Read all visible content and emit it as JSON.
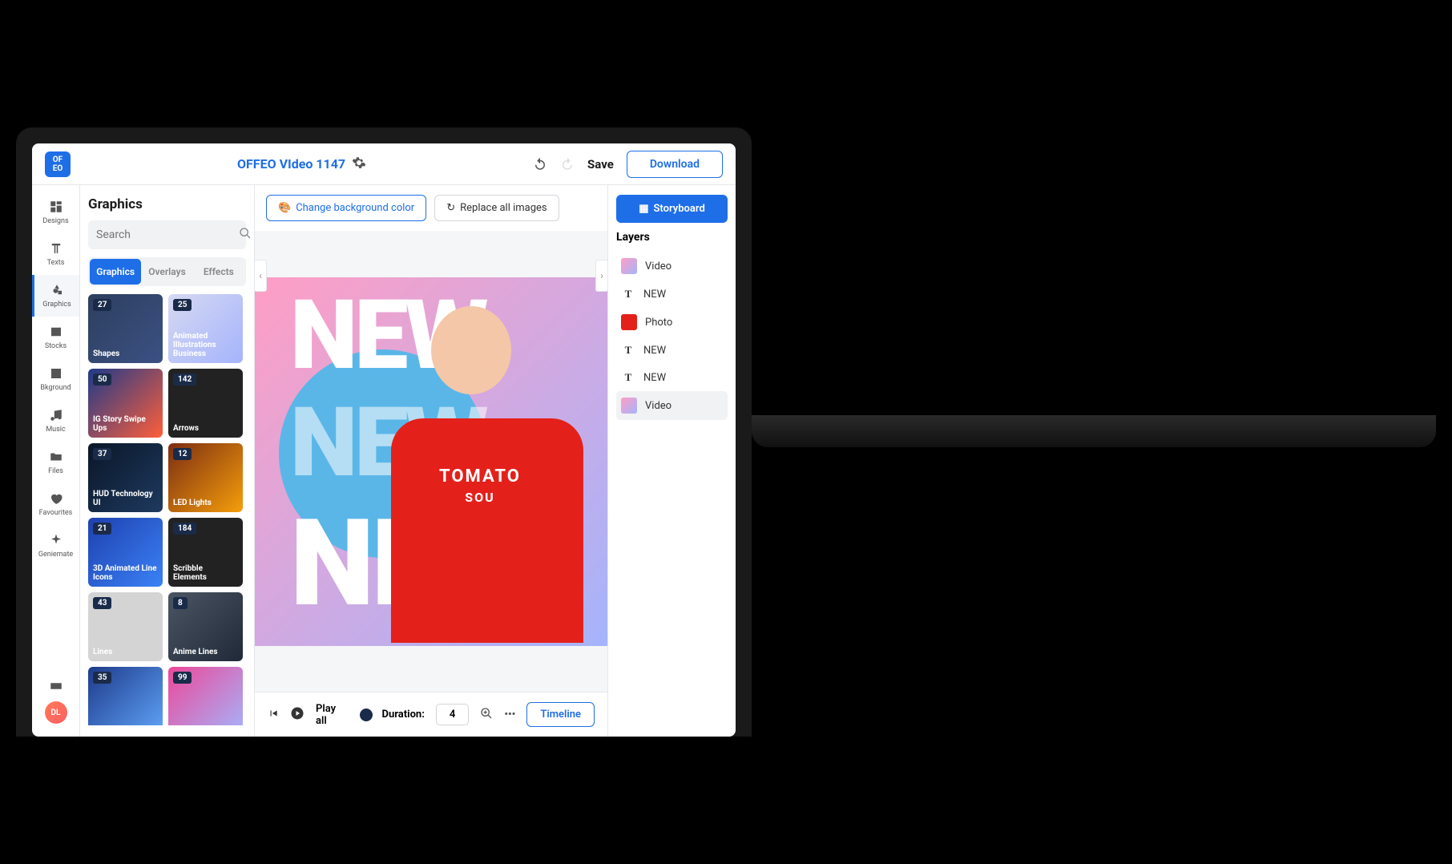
{
  "header": {
    "title": "OFFEO VIdeo 1147",
    "save_label": "Save",
    "download_label": "Download",
    "logo_text": "OF EO"
  },
  "left_nav": {
    "items": [
      {
        "label": "Designs"
      },
      {
        "label": "Texts"
      },
      {
        "label": "Graphics"
      },
      {
        "label": "Stocks"
      },
      {
        "label": "Bkground"
      },
      {
        "label": "Music"
      },
      {
        "label": "Files"
      },
      {
        "label": "Favourites"
      },
      {
        "label": "Geniemate"
      }
    ],
    "avatar_initials": "DL"
  },
  "graphics_panel": {
    "title": "Graphics",
    "search_placeholder": "Search",
    "tabs": [
      {
        "label": "Graphics"
      },
      {
        "label": "Overlays"
      },
      {
        "label": "Effects"
      }
    ],
    "cards": [
      {
        "count": "27",
        "label": "Shapes",
        "bg": "linear-gradient(135deg,#2d3e5e,#3b5183)"
      },
      {
        "count": "25",
        "label": "Animated Illustrations Business",
        "bg": "linear-gradient(135deg,#d6d9f2,#a5b4fc)"
      },
      {
        "count": "50",
        "label": "IG Story Swipe Ups",
        "bg": "linear-gradient(135deg,#1e3a8a,#ff5e3a)"
      },
      {
        "count": "142",
        "label": "Arrows",
        "bg": "#222"
      },
      {
        "count": "37",
        "label": "HUD Technology UI",
        "bg": "linear-gradient(135deg,#0a1628,#1e3a5f)"
      },
      {
        "count": "12",
        "label": "LED Lights",
        "bg": "linear-gradient(135deg,#7c2d12,#f59e0b)"
      },
      {
        "count": "21",
        "label": "3D Animated Line Icons",
        "bg": "linear-gradient(135deg,#1e40af,#3b82f6)"
      },
      {
        "count": "184",
        "label": "Scribble Elements",
        "bg": "#222"
      },
      {
        "count": "43",
        "label": "Lines",
        "bg": "#d4d4d4"
      },
      {
        "count": "8",
        "label": "Anime Lines",
        "bg": "linear-gradient(135deg,#4b5563,#1f2937)"
      },
      {
        "count": "35",
        "label": "",
        "bg": "linear-gradient(135deg,#1e3a8a,#60a5fa)"
      },
      {
        "count": "99",
        "label": "",
        "bg": "linear-gradient(135deg,#ec4899,#a5b4fc)"
      }
    ]
  },
  "toolbar": {
    "change_bg_label": "Change background color",
    "replace_label": "Replace all images"
  },
  "canvas": {
    "text1": "NEW",
    "text2": "NEW",
    "text3": "NEW",
    "person_shirt_line1": "TOMATO",
    "person_shirt_line2": "SOU"
  },
  "playbar": {
    "play_all_label": "Play all",
    "duration_label": "Duration:",
    "duration_value": "4",
    "timeline_label": "Timeline"
  },
  "layers_panel": {
    "storyboard_label": "Storyboard",
    "title": "Layers",
    "layers": [
      {
        "type": "video",
        "label": "Video"
      },
      {
        "type": "text",
        "label": "NEW"
      },
      {
        "type": "photo",
        "label": "Photo"
      },
      {
        "type": "text",
        "label": "NEW"
      },
      {
        "type": "text",
        "label": "NEW"
      },
      {
        "type": "video",
        "label": "Video"
      }
    ]
  }
}
